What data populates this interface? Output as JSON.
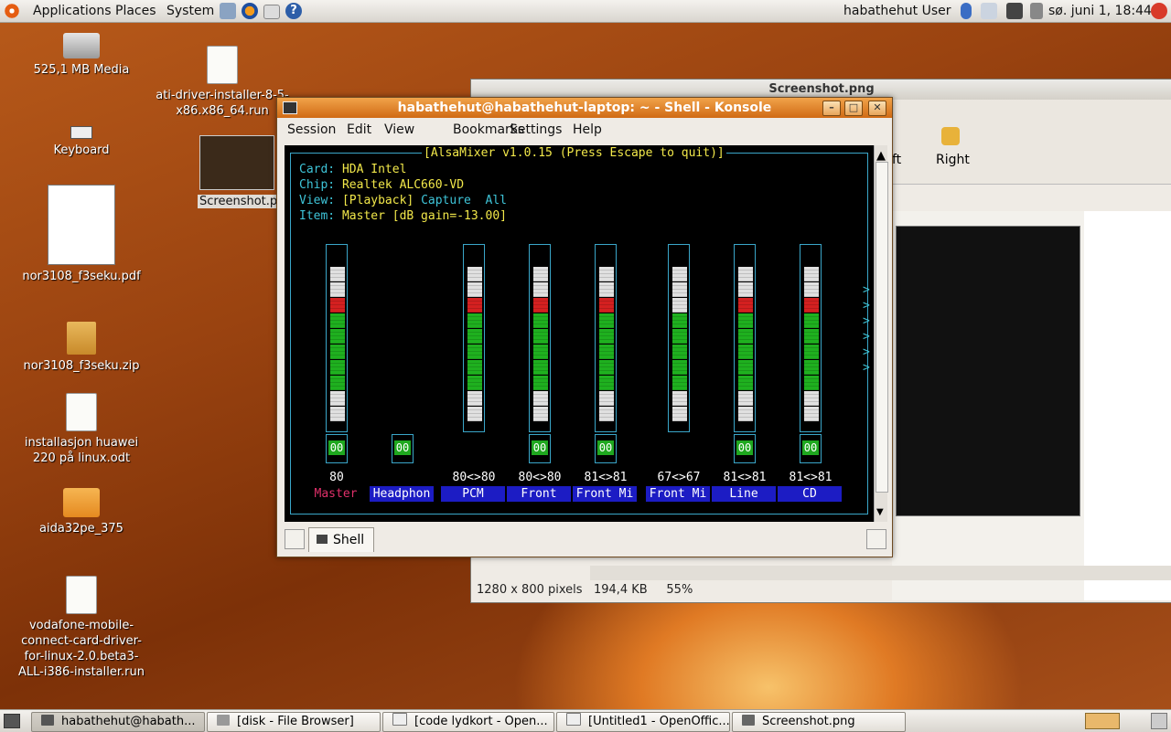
{
  "top_panel": {
    "menu": [
      "Applications",
      "Places",
      "System"
    ],
    "user": "habathehut User",
    "datetime": "sø. juni  1, 18:44"
  },
  "desktop": {
    "icons": [
      {
        "label": "525,1 MB Media",
        "icon": "drive-icon"
      },
      {
        "label": "ati-driver-installer-8-5-x86.x86_64.run",
        "icon": "script-icon"
      },
      {
        "label": "Keyboard",
        "icon": "keyboard-icon"
      },
      {
        "label": "Screenshot.p",
        "icon": "image-icon"
      },
      {
        "label": "nor3108_f3seku.pdf",
        "icon": "pdf-icon"
      },
      {
        "label": "nor3108_f3seku.zip",
        "icon": "zip-icon"
      },
      {
        "label": "installasjon huawei 220 på linux.odt",
        "icon": "document-icon"
      },
      {
        "label": "aida32pe_375",
        "icon": "folder-icon"
      },
      {
        "label": "vodafone-mobile-connect-card-driver-for-linux-2.0.beta3-ALL-i386-installer.run",
        "icon": "script-icon"
      }
    ]
  },
  "viewer": {
    "title": "Screenshot.png",
    "right_label": "Right",
    "left_label": "ft",
    "status_dims": "1280 x 800 pixels",
    "status_size": "194,4 KB",
    "status_zoom": "55%"
  },
  "konsole": {
    "title": "habathehut@habathehut-laptop: ~ - Shell - Konsole",
    "menu": [
      "Session",
      "Edit",
      "View",
      "Bookmarks",
      "Settings",
      "Help"
    ],
    "tab": "Shell",
    "mixer": {
      "header": "[AlsaMixer v1.0.15 (Press Escape to quit)]",
      "card_label": "Card:",
      "card": "HDA Intel",
      "chip_label": "Chip:",
      "chip": "Realtek ALC660-VD",
      "view_label": "View:",
      "view_playback": "[Playback]",
      "view_capture": "Capture",
      "view_all": "All",
      "item_label": "Item:",
      "item": "Master [dB gain=-13.00]",
      "channels": [
        {
          "name": "Master",
          "value": "80",
          "level": 0.8,
          "muted": "00"
        },
        {
          "name": "Headphon",
          "value": "",
          "level": 0,
          "muted": "00"
        },
        {
          "name": "PCM",
          "value": "80<>80",
          "level": 0.8,
          "muted": ""
        },
        {
          "name": "Front",
          "value": "80<>80",
          "level": 0.8,
          "muted": "00"
        },
        {
          "name": "Front Mi",
          "value": "81<>81",
          "level": 0.81,
          "muted": "00"
        },
        {
          "name": "Front Mi",
          "value": "67<>67",
          "level": 0.67,
          "muted": ""
        },
        {
          "name": "Line",
          "value": "81<>81",
          "level": 0.81,
          "muted": "00"
        },
        {
          "name": "CD",
          "value": "81<>81",
          "level": 0.81,
          "muted": "00"
        }
      ]
    }
  },
  "taskbar": {
    "tasks": [
      "habathehut@habath...",
      "[disk - File Browser]",
      "[code lydkort - Open...",
      "[Untitled1 - OpenOffic...",
      "Screenshot.png"
    ]
  },
  "colors": {
    "terminal_bg": "#000000",
    "label": "#3ec4d8",
    "value": "#f2e84a",
    "green": "#1fa81f",
    "red": "#d42020",
    "highlight": "#1c1cc4"
  }
}
